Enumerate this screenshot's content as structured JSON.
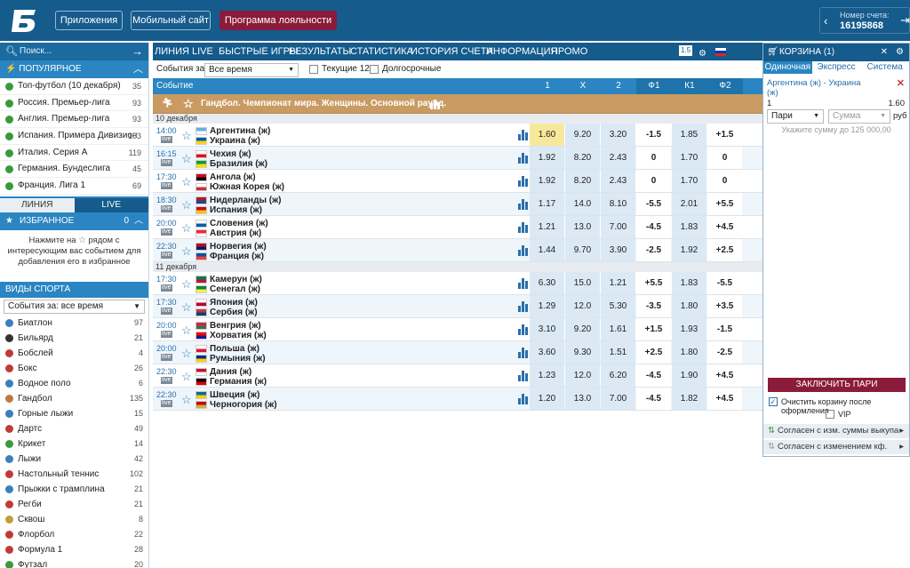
{
  "header": {
    "apps": "Приложения",
    "mobile": "Мобильный сайт",
    "loyalty": "Программа лояльности",
    "account_label": "Номер счета:",
    "account_number": "16195868"
  },
  "left": {
    "search_placeholder": "Поиск...",
    "popular_title": "ПОПУЛЯРНОЕ",
    "popular": [
      {
        "label": "Топ-футбол (10 декабря)",
        "count": "35"
      },
      {
        "label": "Россия. Премьер-лига",
        "count": "93"
      },
      {
        "label": "Англия. Премьер-лига",
        "count": "93"
      },
      {
        "label": "Испания. Примера Дивизион",
        "count": "103"
      },
      {
        "label": "Италия. Серия А",
        "count": "119"
      },
      {
        "label": "Германия. Бундеслига",
        "count": "45"
      },
      {
        "label": "Франция. Лига 1",
        "count": "69"
      }
    ],
    "tab_line": "ЛИНИЯ",
    "tab_live": "LIVE",
    "fav_title": "ИЗБРАННОЕ",
    "fav_count": "0",
    "fav_text_a": "Нажмите на",
    "fav_text_b": "рядом с интересующим вас событием для добавления его в избранное",
    "sports_title": "ВИДЫ СПОРТА",
    "sports_filter": "События за: все время",
    "sports": [
      {
        "label": "Биатлон",
        "count": "97",
        "color": "#3a7fc0"
      },
      {
        "label": "Бильярд",
        "count": "21",
        "color": "#333"
      },
      {
        "label": "Бобслей",
        "count": "4",
        "color": "#c03a3a"
      },
      {
        "label": "Бокс",
        "count": "26",
        "color": "#c03a3a"
      },
      {
        "label": "Водное поло",
        "count": "6",
        "color": "#3a7fc0"
      },
      {
        "label": "Гандбол",
        "count": "135",
        "color": "#c07a3a"
      },
      {
        "label": "Горные лыжи",
        "count": "15",
        "color": "#3a7fc0"
      },
      {
        "label": "Дартс",
        "count": "49",
        "color": "#c03a3a"
      },
      {
        "label": "Крикет",
        "count": "14",
        "color": "#3a9a3a"
      },
      {
        "label": "Лыжи",
        "count": "42",
        "color": "#3a7fc0"
      },
      {
        "label": "Настольный теннис",
        "count": "102",
        "color": "#c03a3a"
      },
      {
        "label": "Прыжки с трамплина",
        "count": "21",
        "color": "#3a7fc0"
      },
      {
        "label": "Регби",
        "count": "21",
        "color": "#c03a3a"
      },
      {
        "label": "Сквош",
        "count": "8",
        "color": "#c0a03a"
      },
      {
        "label": "Флорбол",
        "count": "22",
        "color": "#c03a3a"
      },
      {
        "label": "Формула 1",
        "count": "28",
        "color": "#c03a3a"
      },
      {
        "label": "Футзал",
        "count": "20",
        "color": "#3a9a3a"
      }
    ]
  },
  "nav": [
    "ЛИНИЯ",
    "LIVE",
    "БЫСТРЫЕ ИГРЫ",
    "РЕЗУЛЬТАТЫ",
    "СТАТИСТИКА",
    "ИСТОРИЯ СЧЕТА",
    "ИНФОРМАЦИЯ",
    "ПРОМО"
  ],
  "nav_badge": "1.5",
  "filter": {
    "label": "События за:",
    "value": "Все время",
    "current": "Текущие 12",
    "long": "Долгосрочные"
  },
  "columns": [
    "Событие",
    "1",
    "X",
    "2",
    "Ф1",
    "К1",
    "Ф2"
  ],
  "championship": "Гандбол. Чемпионат мира. Женщины. Основной раунд.",
  "days": [
    {
      "date": "10 декабря",
      "events": [
        {
          "time": "14:00",
          "t1": "Аргентина (ж)",
          "t2": "Украина (ж)",
          "o1": "1.60",
          "x": "9.20",
          "o2": "3.20",
          "f1": "-1.5",
          "k1": "1.85",
          "f2": "+1.5",
          "f1c": [
            "#6cace4",
            "#ffffff"
          ],
          "f2c": [
            "#0057b7",
            "#ffd700"
          ],
          "hl": true
        },
        {
          "time": "16:15",
          "t1": "Чехия (ж)",
          "t2": "Бразилия (ж)",
          "o1": "1.92",
          "x": "8.20",
          "o2": "2.43",
          "f1": "0",
          "k1": "1.70",
          "f2": "0",
          "f1c": [
            "#ffffff",
            "#d7141a"
          ],
          "f2c": [
            "#009c3b",
            "#ffdf00"
          ]
        },
        {
          "time": "17:30",
          "t1": "Ангола (ж)",
          "t2": "Южная Корея (ж)",
          "o1": "1.92",
          "x": "8.20",
          "o2": "2.43",
          "f1": "0",
          "k1": "1.70",
          "f2": "0",
          "f1c": [
            "#cc092f",
            "#000000"
          ],
          "f2c": [
            "#ffffff",
            "#cd2e3a"
          ]
        },
        {
          "time": "18:30",
          "t1": "Нидерланды (ж)",
          "t2": "Испания (ж)",
          "o1": "1.17",
          "x": "14.0",
          "o2": "8.10",
          "f1": "-5.5",
          "k1": "2.01",
          "f2": "+5.5",
          "f1c": [
            "#ae1c28",
            "#21468b"
          ],
          "f2c": [
            "#c60b1e",
            "#ffc400"
          ]
        },
        {
          "time": "20:00",
          "t1": "Словения (ж)",
          "t2": "Австрия (ж)",
          "o1": "1.21",
          "x": "13.0",
          "o2": "7.00",
          "f1": "-4.5",
          "k1": "1.83",
          "f2": "+4.5",
          "f1c": [
            "#ffffff",
            "#005da4"
          ],
          "f2c": [
            "#ed2939",
            "#ffffff"
          ]
        },
        {
          "time": "22:30",
          "t1": "Норвегия (ж)",
          "t2": "Франция (ж)",
          "o1": "1.44",
          "x": "9.70",
          "o2": "3.90",
          "f1": "-2.5",
          "k1": "1.92",
          "f2": "+2.5",
          "f1c": [
            "#ba0c2f",
            "#00205b"
          ],
          "f2c": [
            "#0055a4",
            "#ef4135"
          ]
        }
      ]
    },
    {
      "date": "11 декабря",
      "events": [
        {
          "time": "17:30",
          "t1": "Камерун (ж)",
          "t2": "Сенегал (ж)",
          "o1": "6.30",
          "x": "15.0",
          "o2": "1.21",
          "f1": "+5.5",
          "k1": "1.83",
          "f2": "-5.5",
          "f1c": [
            "#007a5e",
            "#ce1126"
          ],
          "f2c": [
            "#00853f",
            "#fdef42"
          ]
        },
        {
          "time": "17:30",
          "t1": "Япония (ж)",
          "t2": "Сербия (ж)",
          "o1": "1.29",
          "x": "12.0",
          "o2": "5.30",
          "f1": "-3.5",
          "k1": "1.80",
          "f2": "+3.5",
          "f1c": [
            "#ffffff",
            "#bc002d"
          ],
          "f2c": [
            "#c6363c",
            "#0c4076"
          ]
        },
        {
          "time": "20:00",
          "t1": "Венгрия (ж)",
          "t2": "Хорватия (ж)",
          "o1": "3.10",
          "x": "9.20",
          "o2": "1.61",
          "f1": "+1.5",
          "k1": "1.93",
          "f2": "-1.5",
          "f1c": [
            "#cd2a3e",
            "#436f4d"
          ],
          "f2c": [
            "#ff0000",
            "#171796"
          ]
        },
        {
          "time": "20:00",
          "t1": "Польша (ж)",
          "t2": "Румыния (ж)",
          "o1": "3.60",
          "x": "9.30",
          "o2": "1.51",
          "f1": "+2.5",
          "k1": "1.80",
          "f2": "-2.5",
          "f1c": [
            "#ffffff",
            "#dc143c"
          ],
          "f2c": [
            "#002b7f",
            "#fcd116"
          ]
        },
        {
          "time": "22:30",
          "t1": "Дания (ж)",
          "t2": "Германия (ж)",
          "o1": "1.23",
          "x": "12.0",
          "o2": "6.20",
          "f1": "-4.5",
          "k1": "1.90",
          "f2": "+4.5",
          "f1c": [
            "#c8102e",
            "#ffffff"
          ],
          "f2c": [
            "#000000",
            "#dd0000"
          ]
        },
        {
          "time": "22:30",
          "t1": "Швеция (ж)",
          "t2": "Черногория (ж)",
          "o1": "1.20",
          "x": "13.0",
          "o2": "7.00",
          "f1": "-4.5",
          "k1": "1.82",
          "f2": "+4.5",
          "f1c": [
            "#006aa7",
            "#fecc00"
          ],
          "f2c": [
            "#c40308",
            "#d4af37"
          ]
        }
      ]
    }
  ],
  "basket": {
    "title": "КОРЗИНА (1)",
    "tabs": [
      "Одиночная",
      "Экспресс",
      "Система"
    ],
    "event": "Аргентина (ж) - Украина (ж)",
    "outcome": "1",
    "coef": "1.60",
    "bet_type": "Пари",
    "amount_placeholder": "Сумма",
    "currency": "руб",
    "hint": "Укажите сумму до 125 000,00",
    "place": "ЗАКЛЮЧИТЬ ПАРИ",
    "clear": "Очистить корзину после оформления",
    "vip": "VIP",
    "agree1": "Согласен с изм. суммы выкупа",
    "agree2": "Согласен с изменением кф."
  },
  "colors": {
    "header": "#155b8c",
    "accent": "#2a85c2",
    "loyalty": "#8a1b3b",
    "champ": "#c99b62"
  }
}
